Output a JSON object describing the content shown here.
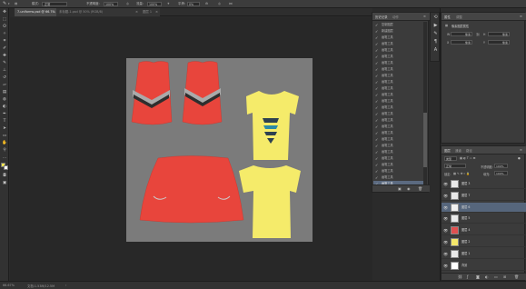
{
  "options_bar": {
    "mode_label": "模式:",
    "mode_value": "正常",
    "opacity_label": "不透明度:",
    "opacity_value": "100%",
    "flow_label": "流量:",
    "flow_value": "100%",
    "smooth_label": "平滑:",
    "smooth_value": "0%"
  },
  "tabs": [
    {
      "label": "7-uniforms.psd @ 66.7% (图层 6, RGB/8) *",
      "close": "×"
    },
    {
      "label": "未标题-1.psd @ 50% (RGB/8)",
      "close": "×"
    },
    {
      "label": "图层 1",
      "close": "×"
    }
  ],
  "history": {
    "tab_history": "历史记录",
    "tab_actions": "动作",
    "items": [
      "复制图层",
      "新建图层",
      "画笔工具",
      "画笔工具",
      "画笔工具",
      "画笔工具",
      "画笔工具",
      "画笔工具",
      "画笔工具",
      "画笔工具",
      "画笔工具",
      "画笔工具",
      "画笔工具",
      "画笔工具",
      "画笔工具",
      "画笔工具",
      "画笔工具",
      "画笔工具",
      "画笔工具",
      "画笔工具",
      "画笔工具",
      "画笔工具",
      "画笔工具",
      "画笔工具",
      "画笔工具",
      "画笔工具"
    ],
    "selected_index": 25
  },
  "properties": {
    "tab_properties": "属性",
    "tab_adjust": "调整",
    "subtitle": "像素图层属性",
    "w_label": "W",
    "w_value": "像素",
    "h_label": "H",
    "h_value": "像素",
    "x_label": "X",
    "x_value": "像素",
    "y_label": "Y",
    "y_value": "像素"
  },
  "layers": {
    "tab_layers": "图层",
    "tab_channels": "通道",
    "tab_paths": "路径",
    "filter_label": "类型",
    "blend_mode": "正常",
    "opacity_label": "不透明度:",
    "opacity_value": "100%",
    "lock_label": "锁定:",
    "fill_label": "填充:",
    "fill_value": "100%",
    "items": [
      {
        "name": "图层 3",
        "thumb": "#e9e9e9"
      },
      {
        "name": "图层 7",
        "thumb": "#e9e9e9"
      },
      {
        "name": "图层 6",
        "thumb": "#f0f0f0"
      },
      {
        "name": "图层 5",
        "thumb": "#e9e9e9"
      },
      {
        "name": "图层 4",
        "thumb": "#e05050"
      },
      {
        "name": "图层 2",
        "thumb": "#f4e76a"
      },
      {
        "name": "图层 1",
        "thumb": "#e9e9e9"
      },
      {
        "name": "背景",
        "thumb": "#ffffff"
      }
    ],
    "selected_index": 2
  },
  "status": {
    "zoom": "66.67%",
    "doc": "文档:1.53M/12.5M"
  },
  "colors": {
    "red": "#e8453c",
    "yellow": "#f5eb6a",
    "gray_chevron": "#aaaaaa",
    "navy": "#2d4150",
    "teal": "#2b8aa6",
    "selection_blue": "#5b6a80"
  }
}
